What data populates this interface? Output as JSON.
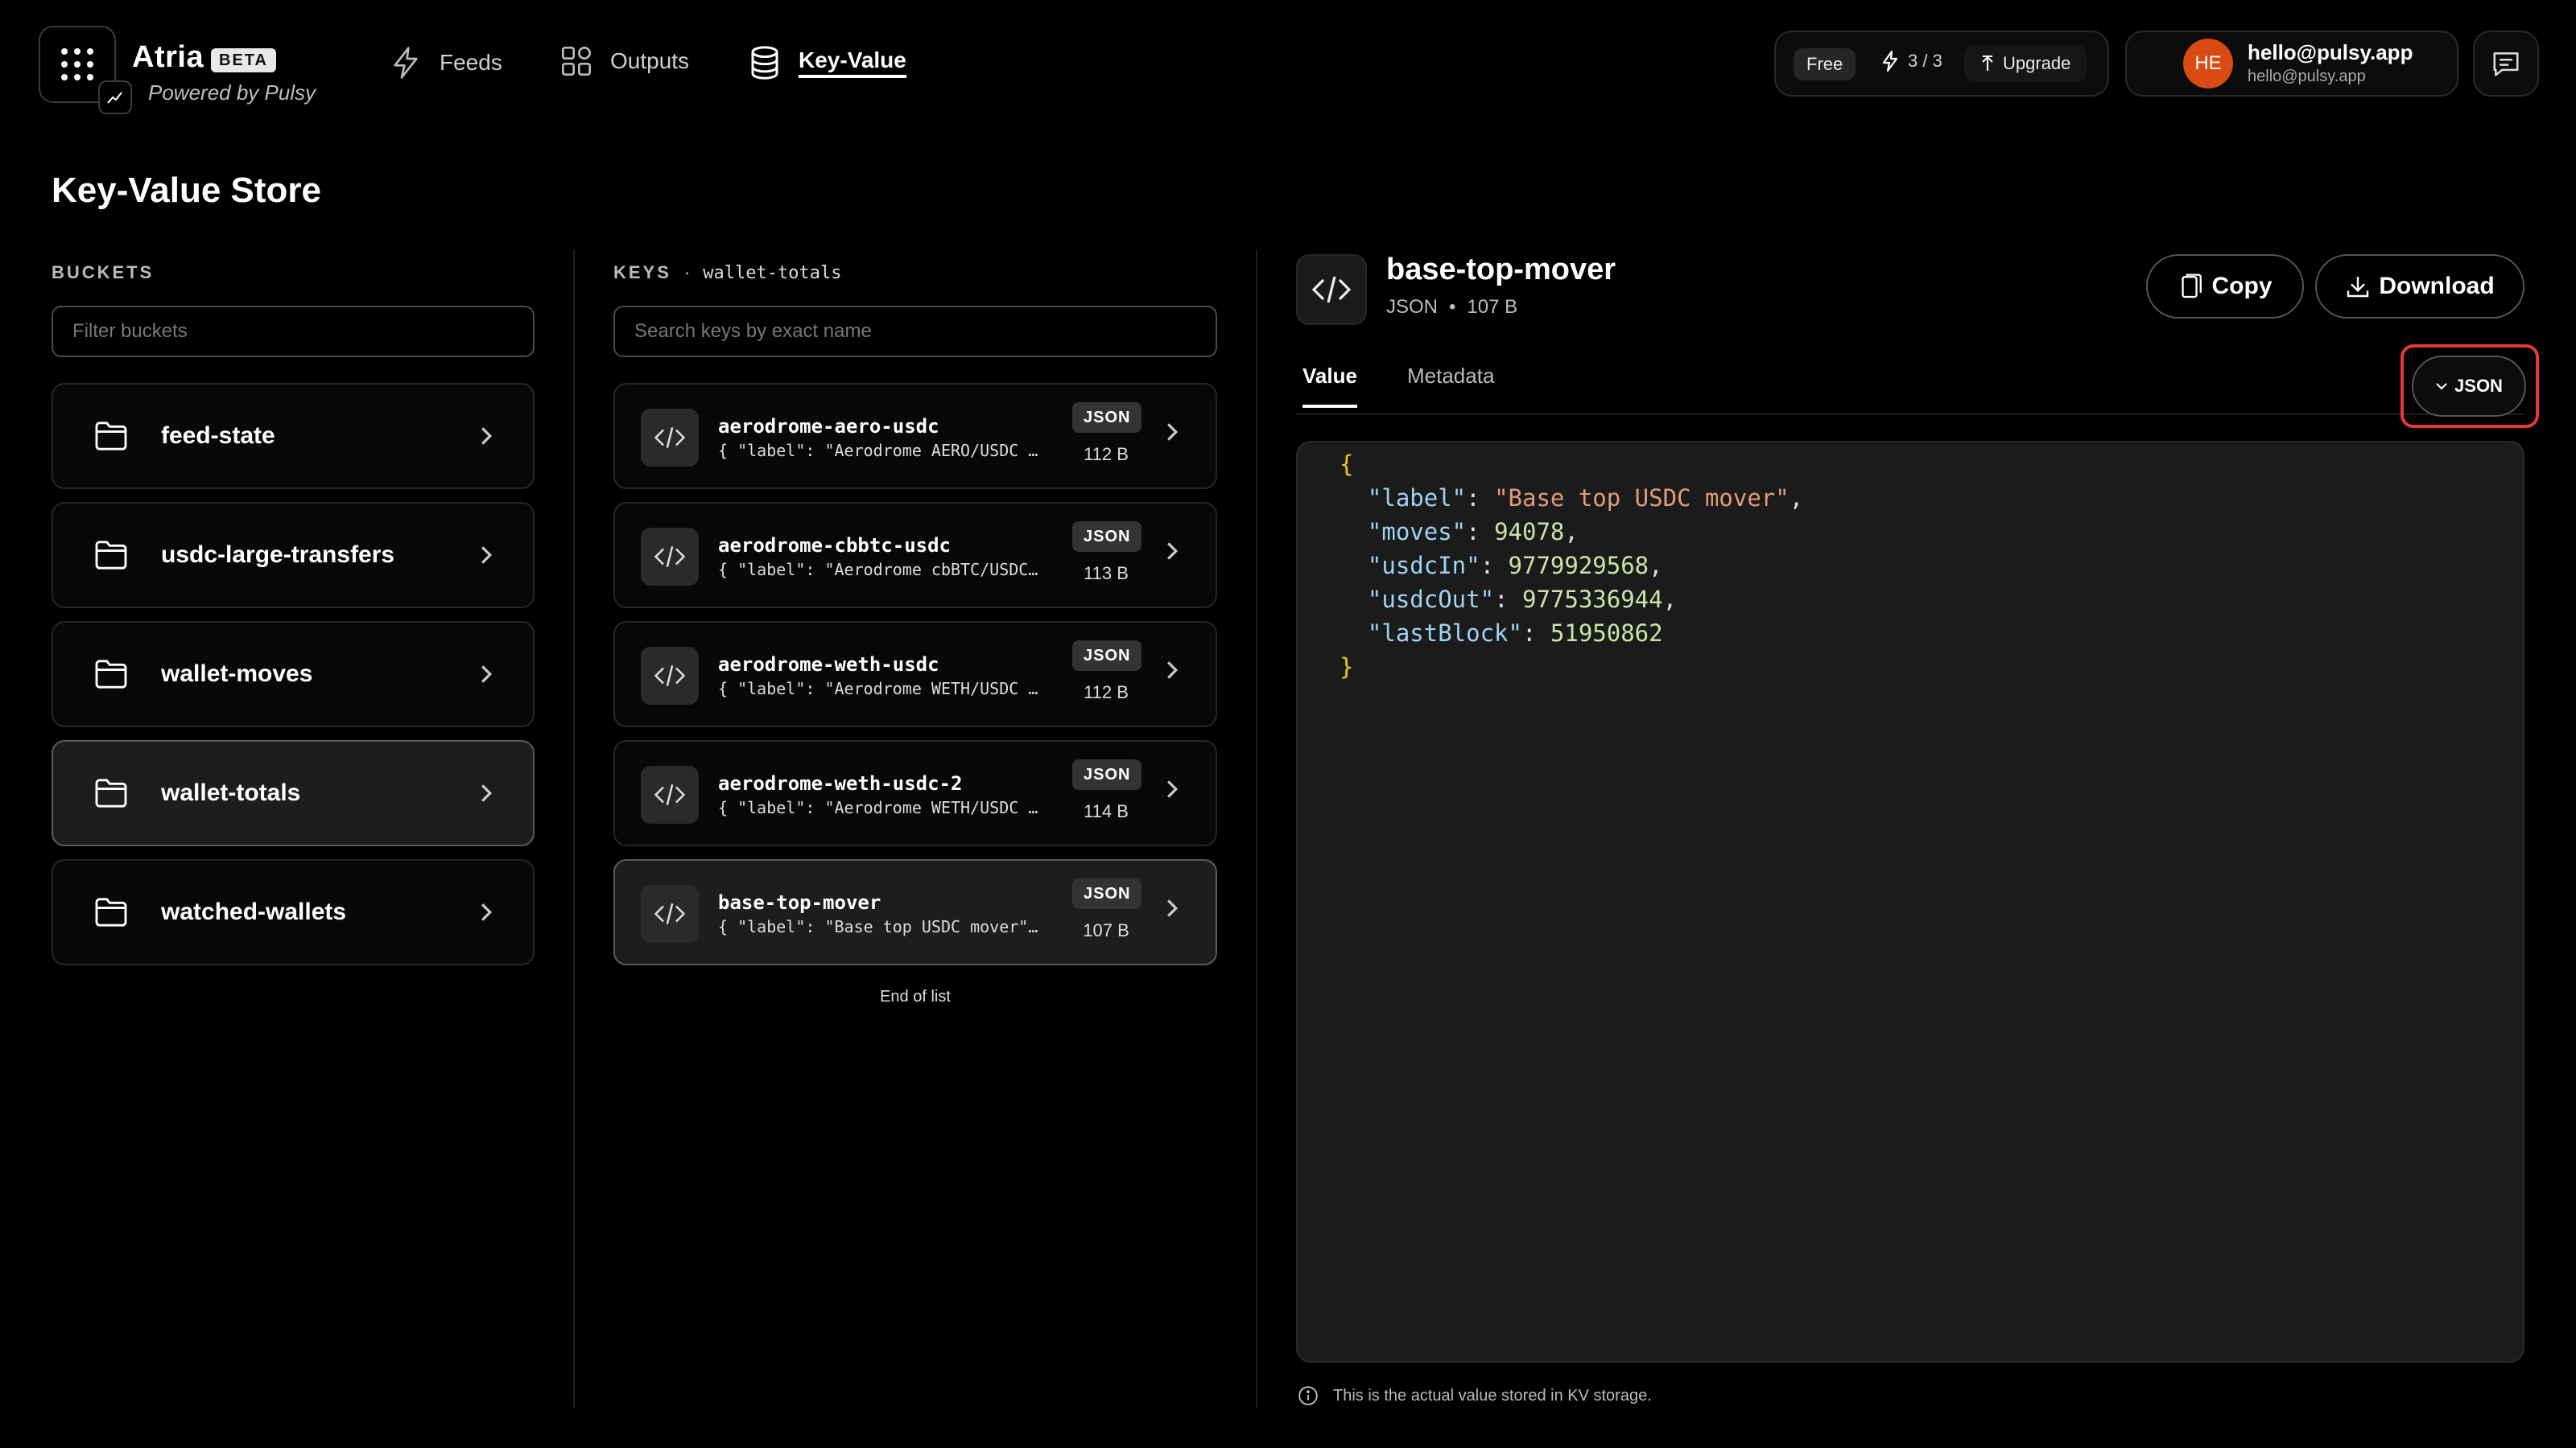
{
  "brand": {
    "name": "Atria",
    "badge": "BETA",
    "powered_by": "Powered by Pulsy"
  },
  "nav": {
    "feeds": "Feeds",
    "outputs": "Outputs",
    "key_value": "Key-Value"
  },
  "plan": {
    "tier": "Free",
    "credits": "3 / 3",
    "upgrade": "Upgrade"
  },
  "user": {
    "initials": "HE",
    "email": "hello@pulsy.app",
    "email_sub": "hello@pulsy.app"
  },
  "page": {
    "title": "Key-Value Store"
  },
  "buckets": {
    "label": "BUCKETS",
    "filter_placeholder": "Filter buckets",
    "items": [
      {
        "name": "feed-state"
      },
      {
        "name": "usdc-large-transfers"
      },
      {
        "name": "wallet-moves"
      },
      {
        "name": "wallet-totals",
        "active": true
      },
      {
        "name": "watched-wallets"
      }
    ]
  },
  "keys": {
    "label": "KEYS",
    "separator": "·",
    "bucket": "wallet-totals",
    "search_placeholder": "Search keys by exact name",
    "items": [
      {
        "name": "aerodrome-aero-usdc",
        "preview": "{ \"label\": \"Aerodrome AERO/USDC p…",
        "type": "JSON",
        "size": "112 B"
      },
      {
        "name": "aerodrome-cbbtc-usdc",
        "preview": "{ \"label\": \"Aerodrome cbBTC/USDC …",
        "type": "JSON",
        "size": "113 B"
      },
      {
        "name": "aerodrome-weth-usdc",
        "preview": "{ \"label\": \"Aerodrome WETH/USDC p…",
        "type": "JSON",
        "size": "112 B"
      },
      {
        "name": "aerodrome-weth-usdc-2",
        "preview": "{ \"label\": \"Aerodrome WETH/USDC p…",
        "type": "JSON",
        "size": "114 B"
      },
      {
        "name": "base-top-mover",
        "preview": "{ \"label\": \"Base top USDC mover\",…",
        "type": "JSON",
        "size": "107 B",
        "active": true
      }
    ],
    "end_text": "End of list"
  },
  "detail": {
    "title": "base-top-mover",
    "type": "JSON",
    "dot": "•",
    "size": "107 B",
    "copy_label": "Copy",
    "download_label": "Download",
    "tabs": {
      "value": "Value",
      "metadata": "Metadata"
    },
    "format_toggle": "JSON",
    "value": {
      "label": "\"Base top USDC mover\"",
      "moves": "94078",
      "usdcIn": "9779929568",
      "usdcOut": "9775336944",
      "lastBlock": "51950862"
    },
    "note": "This is the actual value stored in KV storage."
  },
  "icons": {
    "app_grid": "grid-icon",
    "feeds": "lightning-icon",
    "outputs": "widgets-icon",
    "kv": "database-icon",
    "folder": "folder-icon",
    "code": "code-icon",
    "chat": "chat-icon"
  },
  "colors": {
    "accent_avatar": "#d94b13",
    "highlight": "#e53935",
    "json_key": "#9fd3f0",
    "json_string": "#e39b7b",
    "json_number": "#cde3a8",
    "json_brace": "#f5c518"
  }
}
